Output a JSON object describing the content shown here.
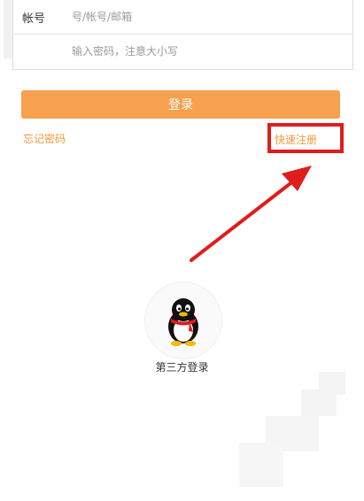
{
  "form": {
    "account_label": "帐号",
    "account_placeholder": "号/帐号/邮箱",
    "password_placeholder": "输入密码，注意大小写"
  },
  "actions": {
    "login_label": "登录",
    "forgot_label": "忘记密码",
    "register_label": "快速注册"
  },
  "third_party": {
    "label": "第三方登录",
    "icon": "qq-penguin-icon"
  },
  "annotation": {
    "highlight_color": "#e01c1c",
    "arrow_color": "#e01c1c"
  },
  "colors": {
    "accent": "#f7a04d",
    "link": "#f29a3f"
  }
}
